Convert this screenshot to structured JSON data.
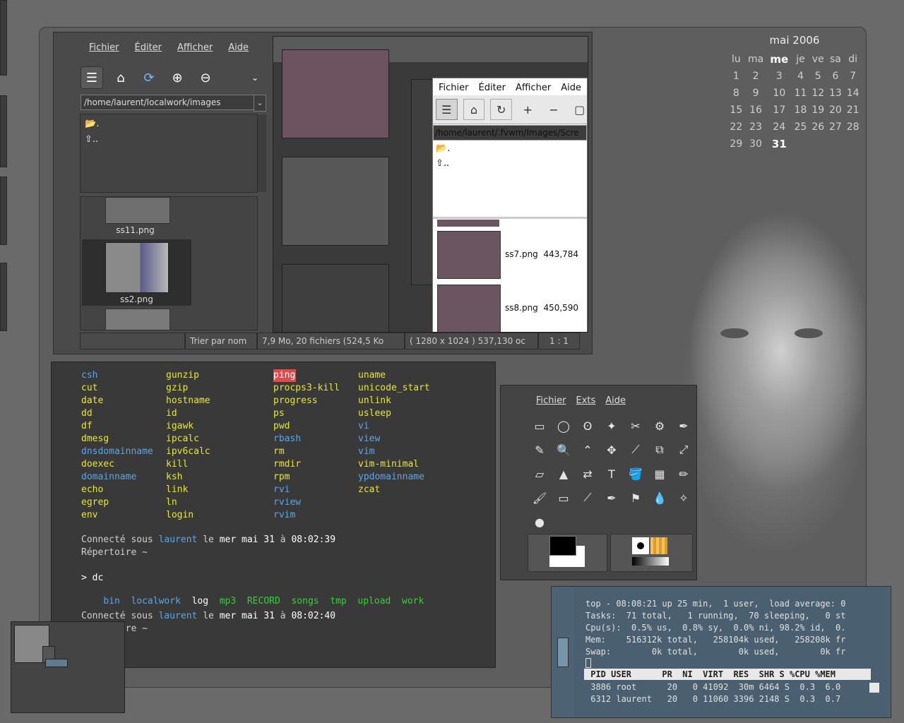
{
  "calendar": {
    "month": "mai 2006",
    "weekdays": [
      "lu",
      "ma",
      "me",
      "je",
      "ve",
      "sa",
      "di"
    ],
    "weeks": [
      [
        "1",
        "2",
        "3",
        "4",
        "5",
        "6",
        "7"
      ],
      [
        "8",
        "9",
        "10",
        "11",
        "12",
        "13",
        "14"
      ],
      [
        "15",
        "16",
        "17",
        "18",
        "19",
        "20",
        "21"
      ],
      [
        "22",
        "23",
        "24",
        "25",
        "26",
        "27",
        "28"
      ],
      [
        "29",
        "30",
        "31",
        "",
        "",
        "",
        ""
      ]
    ],
    "today": "31"
  },
  "file_browser": {
    "menu": [
      "Fichier",
      "Éditer",
      "Afficher",
      "Aide"
    ],
    "path": "/home/laurent/localwork/images",
    "dir_entries": [
      ".",
      ".."
    ],
    "thumbs": [
      "ss11.png",
      "ss2.png"
    ],
    "status": [
      "Trier par nom",
      "7,9 Mo, 20 fichiers (524,5 Ko",
      "( 1280 x 1024 ) 537,130 oc",
      "1 : 1"
    ]
  },
  "inner_viewer": {
    "menu": [
      "Fichier",
      "Éditer",
      "Afficher",
      "Aide"
    ],
    "path": "/home/laurent/.fvwm/Images/Scre",
    "dir_entries": [
      ".",
      ".."
    ],
    "rows": [
      {
        "name": "ss7.png",
        "size": "443,784"
      },
      {
        "name": "ss8.png",
        "size": "450,590"
      }
    ]
  },
  "terminal": {
    "columns": [
      [
        {
          "t": "csh",
          "c": "b"
        },
        {
          "t": "cut",
          "c": "y"
        },
        {
          "t": "date",
          "c": "y"
        },
        {
          "t": "dd",
          "c": "y"
        },
        {
          "t": "df",
          "c": "y"
        },
        {
          "t": "dmesg",
          "c": "y"
        },
        {
          "t": "dnsdomainname",
          "c": "b"
        },
        {
          "t": "doexec",
          "c": "y"
        },
        {
          "t": "domainname",
          "c": "b"
        },
        {
          "t": "echo",
          "c": "y"
        },
        {
          "t": "egrep",
          "c": "y"
        },
        {
          "t": "env",
          "c": "y"
        }
      ],
      [
        {
          "t": "gunzip",
          "c": "y"
        },
        {
          "t": "gzip",
          "c": "y"
        },
        {
          "t": "hostname",
          "c": "y"
        },
        {
          "t": "id",
          "c": "y"
        },
        {
          "t": "igawk",
          "c": "y"
        },
        {
          "t": "ipcalc",
          "c": "y"
        },
        {
          "t": "ipv6calc",
          "c": "y"
        },
        {
          "t": "kill",
          "c": "y"
        },
        {
          "t": "ksh",
          "c": "y"
        },
        {
          "t": "link",
          "c": "y"
        },
        {
          "t": "ln",
          "c": "y"
        },
        {
          "t": "login",
          "c": "y"
        }
      ],
      [
        {
          "t": "ping",
          "c": "hl"
        },
        {
          "t": "procps3-kill",
          "c": "y"
        },
        {
          "t": "progress",
          "c": "y"
        },
        {
          "t": "ps",
          "c": "y"
        },
        {
          "t": "pwd",
          "c": "y"
        },
        {
          "t": "rbash",
          "c": "b"
        },
        {
          "t": "rm",
          "c": "y"
        },
        {
          "t": "rmdir",
          "c": "y"
        },
        {
          "t": "rpm",
          "c": "y"
        },
        {
          "t": "rvi",
          "c": "b"
        },
        {
          "t": "rview",
          "c": "b"
        },
        {
          "t": "rvim",
          "c": "b"
        }
      ],
      [
        {
          "t": "uname",
          "c": "y"
        },
        {
          "t": "unicode_start",
          "c": "y"
        },
        {
          "t": "unlink",
          "c": "y"
        },
        {
          "t": "usleep",
          "c": "y"
        },
        {
          "t": "vi",
          "c": "b"
        },
        {
          "t": "view",
          "c": "b"
        },
        {
          "t": "vim",
          "c": "b"
        },
        {
          "t": "vim-minimal",
          "c": "y"
        },
        {
          "t": "ypdomainname",
          "c": "b"
        },
        {
          "t": "zcat",
          "c": "y"
        }
      ]
    ],
    "login1": {
      "a": "Connecté sous ",
      "user": "laurent",
      "b": " le ",
      "day": "mer mai 31",
      "c": " à ",
      "time": "08:02:39"
    },
    "repertoire": "Répertoire ~",
    "prompt": "> dc",
    "dirs": [
      "bin",
      "localwork",
      "log",
      "mp3",
      "RECORD",
      "songs",
      "tmp",
      "upload",
      "work"
    ],
    "login2": {
      "a": "Connecté sous ",
      "user": "laurent",
      "b": " le ",
      "day": "mer mai 31",
      "c": " à ",
      "time": "08:02:40"
    },
    "repertoire2": "Répertoire ~"
  },
  "gimp": {
    "menu": [
      "Fichier",
      "Exts",
      "Aide"
    ],
    "tools": [
      "▭",
      "◯",
      "ʘ",
      "✦",
      "✂",
      "⚙",
      "✒",
      "✎",
      "🔍",
      "⌃",
      "✥",
      "⟋",
      "⧉",
      "⤢",
      "▱",
      "▲",
      "⇄",
      "T",
      "🪣",
      "▦",
      "✏",
      "🖌",
      "▭",
      "⟋",
      "✒",
      "⚑",
      "💧",
      "✧",
      "●"
    ]
  },
  "top": {
    "lines": [
      "top - 08:08:21 up 25 min,  1 user,  load average: 0",
      "Tasks:  71 total,   1 running,  70 sleeping,   0 st",
      "Cpu(s):  0.5% us,  0.8% sy,  0.0% ni, 98.2% id,  0.",
      "Mem:    516312k total,   258104k used,   258208k fr",
      "Swap:        0k total,        0k used,        0k fr"
    ],
    "header": " PID USER      PR  NI  VIRT  RES  SHR S %CPU %MEM",
    "procs": [
      " 3886 root      20   0 41092  30m 6464 S  0.3  6.0",
      " 6312 laurent   20   0 11060 3396 2148 S  0.3  0.7"
    ]
  }
}
